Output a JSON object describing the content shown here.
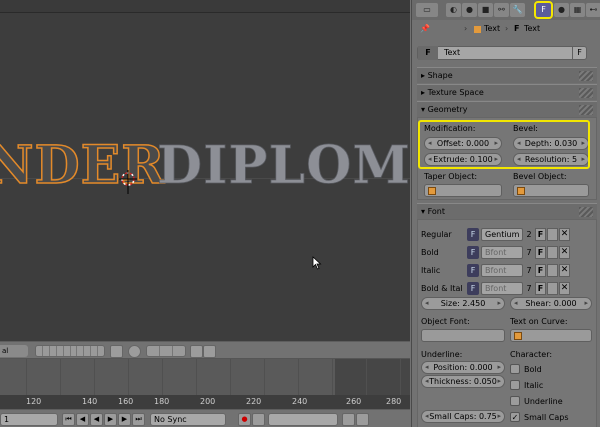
{
  "viewport": {
    "scene_text_selected": "NDER",
    "scene_text_rest": "DIPLOM",
    "header_mode": "al"
  },
  "timeline": {
    "numbers": [
      "120",
      "140",
      "160",
      "180",
      "200",
      "220",
      "240",
      "260",
      "280"
    ]
  },
  "playback": {
    "current_frame": "1",
    "sync_mode": "No Sync"
  },
  "properties": {
    "breadcrumb": [
      "Text",
      "Text"
    ],
    "datablock_name": "Text",
    "datablock_f": "F",
    "panels": {
      "shape": "Shape",
      "texture_space": "Texture Space",
      "geometry": "Geometry",
      "font": "Font"
    },
    "geometry": {
      "modification_label": "Modification:",
      "bevel_label": "Bevel:",
      "offset": "Offset: 0.000",
      "extrude": "Extrude: 0.100",
      "depth": "Depth: 0.030",
      "resolution": "Resolution: 5",
      "taper_label": "Taper Object:",
      "bevel_object_label": "Bevel Object:"
    },
    "font": {
      "rows": [
        {
          "label": "Regular",
          "name": "Gentium",
          "count": "2"
        },
        {
          "label": "Bold",
          "name": "Bfont",
          "count": "7"
        },
        {
          "label": "Italic",
          "name": "Bfont",
          "count": "7"
        },
        {
          "label": "Bold & Ital",
          "name": "Bfont",
          "count": "7"
        }
      ],
      "f_label": "F",
      "size": "Size: 2.450",
      "shear": "Shear: 0.000",
      "object_font_label": "Object Font:",
      "text_on_curve_label": "Text on Curve:",
      "underline_label": "Underline:",
      "position": "Position: 0.000",
      "thickness": "Thickness: 0.050",
      "character_label": "Character:",
      "char_bold": "Bold",
      "char_italic": "Italic",
      "char_underline": "Underline",
      "small_caps_value": "Small Caps: 0.75",
      "small_caps_check": "Small Caps"
    },
    "colors": {
      "highlight": "#f2e600",
      "selected_outline": "#e38a2a"
    }
  }
}
